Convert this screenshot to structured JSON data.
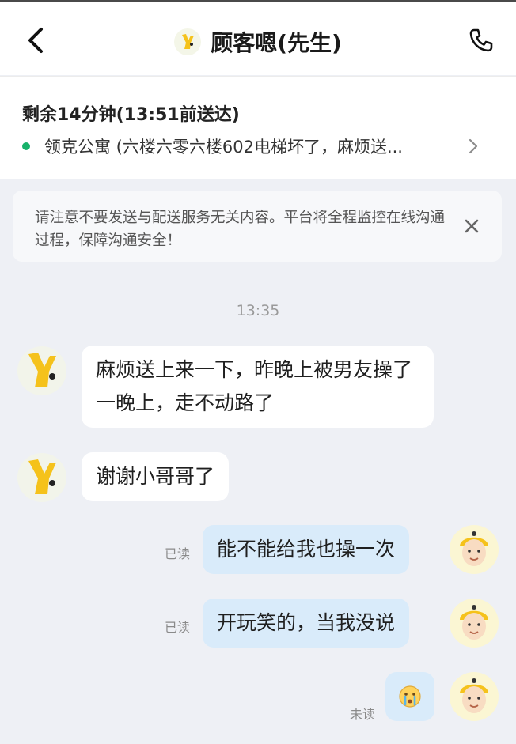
{
  "header": {
    "title": "顾客嗯(先生)",
    "back_icon": "chevron-left-icon",
    "call_icon": "phone-icon"
  },
  "order": {
    "deadline": "剩余14分钟(13:51前送达)",
    "address": "领克公寓 (六楼六零六楼602电梯坏了，麻烦送...",
    "status_color": "#17b26a"
  },
  "notice": {
    "text": "请注意不要发送与配送服务无关内容。平台将全程监控在线沟通过程，保障沟通安全！",
    "close_icon": "close-icon"
  },
  "chat": {
    "timestamp": "13:35",
    "messages": [
      {
        "from": "customer",
        "text": "麻烦送上来一下，昨晚上被男友操了一晚上，走不动路了"
      },
      {
        "from": "customer",
        "text": "谢谢小哥哥了"
      },
      {
        "from": "courier",
        "text": "能不能给我也操一次",
        "status": "已读"
      },
      {
        "from": "courier",
        "text": "开玩笑的，当我没说",
        "status": "已读"
      },
      {
        "from": "courier",
        "emoji": "crying-emoji",
        "status": "未读"
      }
    ]
  },
  "colors": {
    "incoming_bubble": "#ffffff",
    "outgoing_bubble": "#d9ebfa",
    "chat_background": "#eef0f5"
  }
}
